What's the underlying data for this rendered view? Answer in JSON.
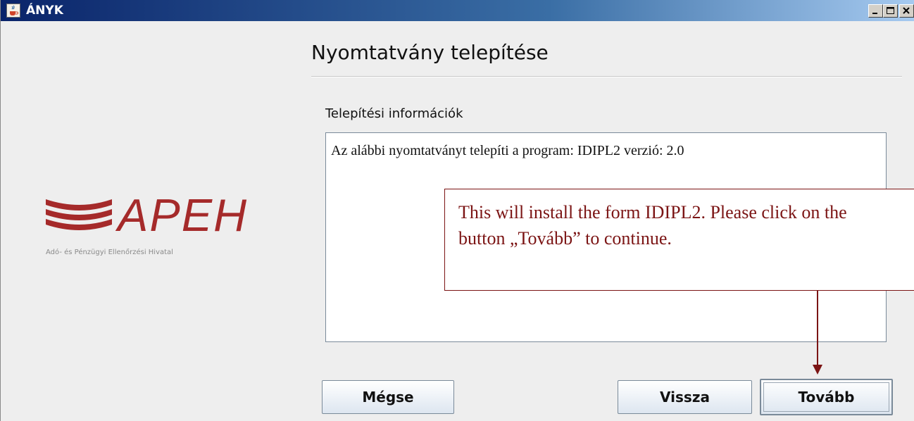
{
  "window": {
    "title": "ÁNYK",
    "controls": [
      "minimize",
      "maximize",
      "close"
    ]
  },
  "header": {
    "title": "Nyomtatvány telepítése"
  },
  "logo": {
    "brand": "APEH",
    "subtitle": "Adó- és Pénzügyi Ellenőrzési Hivatal",
    "color": "#a52a2a"
  },
  "info": {
    "label": "Telepítési információk",
    "text": "Az alábbi nyomtatványt telepíti a program: IDIPL2 verzió: 2.0"
  },
  "callout": {
    "text": "This will install the form IDIPL2. Please click on the button „Tovább” to continue.",
    "color": "#7b1414"
  },
  "buttons": {
    "cancel": "Mégse",
    "back": "Vissza",
    "next": "Tovább"
  },
  "icons": {
    "app": "java-cup-icon",
    "minimize": "minimize-icon",
    "maximize": "maximize-icon",
    "close": "close-icon"
  }
}
